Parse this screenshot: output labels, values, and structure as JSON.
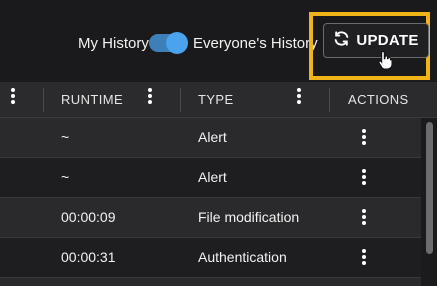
{
  "toolbar": {
    "my_history_label": "My History",
    "everyone_history_label": "Everyone's History",
    "toggle_state": "on",
    "update_label": "UPDATE",
    "update_icon": "refresh-icon"
  },
  "colors": {
    "accent": "#4aa3ec",
    "highlight": "#f0b418",
    "background": "#1f1f21"
  },
  "table": {
    "headers": {
      "runtime": "RUNTIME",
      "type": "TYPE",
      "actions": "ACTIONS"
    },
    "rows": [
      {
        "runtime": "~",
        "type": "Alert"
      },
      {
        "runtime": "~",
        "type": "Alert"
      },
      {
        "runtime": "00:00:09",
        "type": "File modification"
      },
      {
        "runtime": "00:00:31",
        "type": "Authentication"
      }
    ]
  }
}
